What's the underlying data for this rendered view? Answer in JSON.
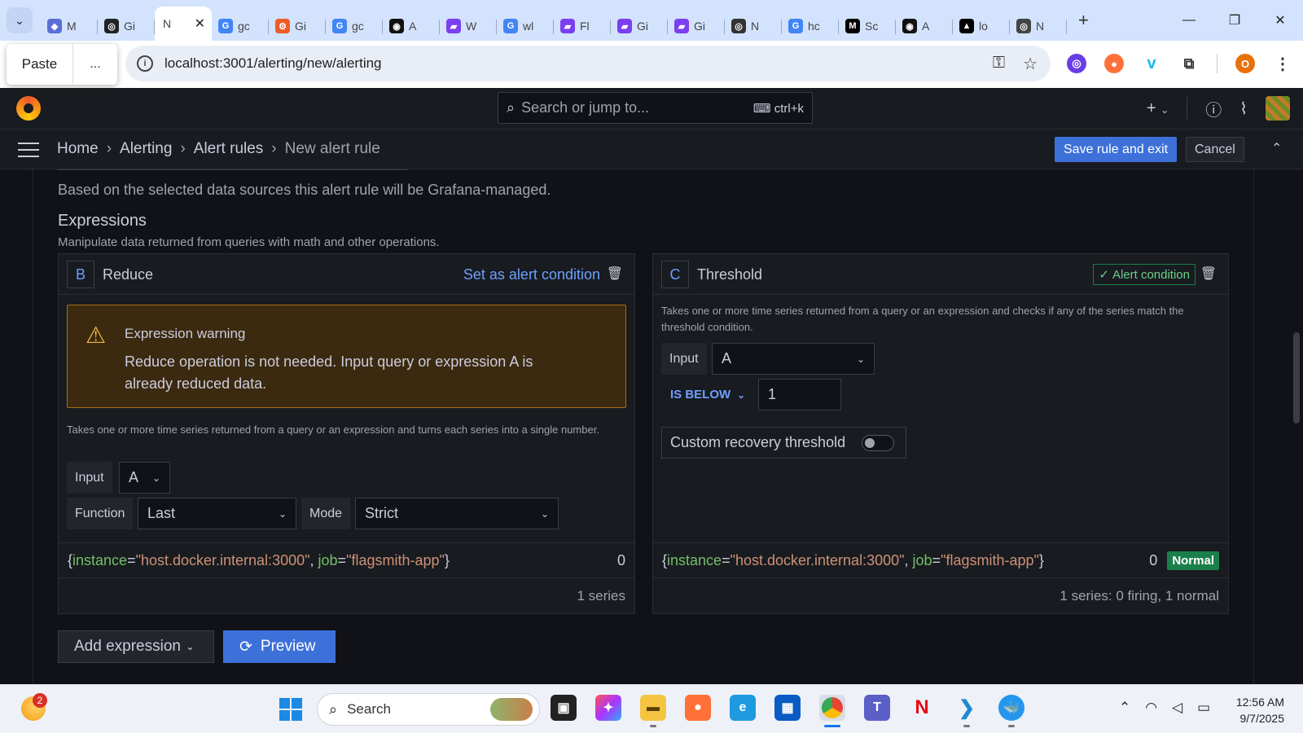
{
  "browser": {
    "tabs": [
      {
        "label": "M",
        "color": "#5b6fd6",
        "glyph": "◆"
      },
      {
        "label": "Gi",
        "color": "#222222",
        "glyph": "◎"
      },
      {
        "label": "N",
        "color": "#ffffff",
        "glyph": "",
        "active": true
      },
      {
        "label": "gc",
        "color": "#4285f4",
        "glyph": "G"
      },
      {
        "label": "Gi",
        "color": "#f05a28",
        "glyph": "⚙"
      },
      {
        "label": "gc",
        "color": "#4285f4",
        "glyph": "G"
      },
      {
        "label": "A",
        "color": "#111111",
        "glyph": "◉"
      },
      {
        "label": "W",
        "color": "#7b3ff2",
        "glyph": "▰"
      },
      {
        "label": "wl",
        "color": "#4285f4",
        "glyph": "G"
      },
      {
        "label": "Fl",
        "color": "#7b3ff2",
        "glyph": "▰"
      },
      {
        "label": "Gi",
        "color": "#7b3ff2",
        "glyph": "▰"
      },
      {
        "label": "Gi",
        "color": "#7b3ff2",
        "glyph": "▰"
      },
      {
        "label": "N",
        "color": "#333333",
        "glyph": "◎"
      },
      {
        "label": "hc",
        "color": "#4285f4",
        "glyph": "G"
      },
      {
        "label": "Sc",
        "color": "#000000",
        "glyph": "M"
      },
      {
        "label": "A",
        "color": "#111111",
        "glyph": "◉"
      },
      {
        "label": "lo",
        "color": "#000000",
        "glyph": "▲"
      },
      {
        "label": "N",
        "color": "#444444",
        "glyph": "◎"
      }
    ],
    "active_tab_close": "✕",
    "new_tab": "+",
    "window_controls": {
      "minimize": "—",
      "restore": "❐",
      "close": "✕"
    },
    "paste_popup": {
      "paste_label": "Paste",
      "more_label": "..."
    },
    "url": "localhost:3001/alerting/new/alerting",
    "profile_initial": "O"
  },
  "grafana": {
    "search_placeholder": "Search or jump to...",
    "search_shortcut": "ctrl+k",
    "breadcrumbs": [
      "Home",
      "Alerting",
      "Alert rules",
      "New alert rule"
    ],
    "save_label": "Save rule and exit",
    "cancel_label": "Cancel",
    "note": "Based on the selected data sources this alert rule will be Grafana-managed.",
    "expressions_title": "Expressions",
    "expressions_subtitle": "Manipulate data returned from queries with math and other operations.",
    "reduce": {
      "ref": "B",
      "title": "Reduce",
      "set_condition": "Set as alert condition",
      "warning_title": "Expression warning",
      "warning_body": "Reduce operation is not needed. Input query or expression A is already reduced data.",
      "description": "Takes one or more time series returned from a query or an expression and turns each series into a single number.",
      "input_label": "Input",
      "input_value": "A",
      "function_label": "Function",
      "function_value": "Last",
      "mode_label": "Mode",
      "mode_value": "Strict",
      "series_value": "0",
      "series_footer": "1 series"
    },
    "threshold": {
      "ref": "C",
      "title": "Threshold",
      "alert_condition": "Alert condition",
      "description": "Takes one or more time series returned from a query or an expression and checks if any of the series match the threshold condition.",
      "input_label": "Input",
      "input_value": "A",
      "operator": "IS BELOW",
      "threshold_value": "1",
      "recovery_label": "Custom recovery threshold",
      "series_value": "0",
      "series_state": "Normal",
      "series_footer": "1 series: 0 firing, 1 normal"
    },
    "series_labels": {
      "instance_key": "instance",
      "instance_value": "\"host.docker.internal:3000\"",
      "job_key": "job",
      "job_value": "\"flagsmith-app\""
    },
    "add_expression_label": "Add expression",
    "preview_label": "Preview"
  },
  "taskbar": {
    "weather_badge": "2",
    "search_label": "Search",
    "time": "12:56 AM",
    "date": "9/7/2025"
  },
  "colors": {
    "accent_blue": "#3d71d9",
    "link_blue": "#6e9fff",
    "success_green": "#1a7f4b",
    "warning_bg": "#3b2a10"
  }
}
